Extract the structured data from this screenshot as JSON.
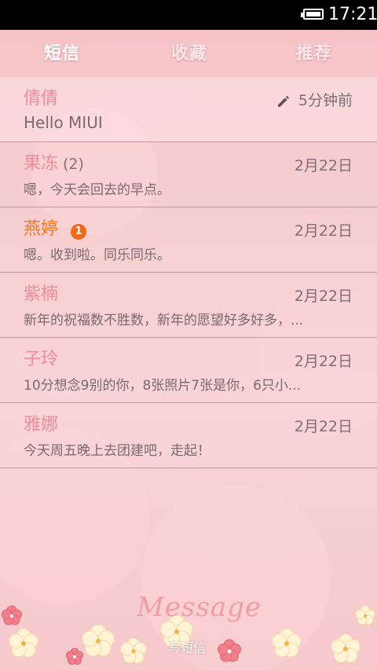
{
  "status_bar": {
    "time": "17:21",
    "battery_icon": "battery-full-icon"
  },
  "tabs": [
    {
      "label": "短信",
      "active": true
    },
    {
      "label": "收藏",
      "active": false
    },
    {
      "label": "推荐",
      "active": false
    }
  ],
  "conversations": [
    {
      "name": "倩倩",
      "count": "",
      "badge": "",
      "date": "5分钟前",
      "preview": "Hello MIUI",
      "draft_icon": "pencil-icon"
    },
    {
      "name": "果冻",
      "count": "(2)",
      "badge": "",
      "date": "2月22日",
      "preview": "嗯，今天会回去的早点。"
    },
    {
      "name": "燕婷",
      "count": "",
      "badge": "1",
      "date": "2月22日",
      "preview": "嗯。收到啦。同乐同乐。"
    },
    {
      "name": "紫楠",
      "count": "",
      "badge": "",
      "date": "2月22日",
      "preview": "新年的祝福数不胜数，新年的愿望好多好多，..."
    },
    {
      "name": "子玲",
      "count": "",
      "badge": "",
      "date": "2月22日",
      "preview": "10分想念9别的你，8张照片7张是你，6只小..."
    },
    {
      "name": "雅娜",
      "count": "",
      "badge": "",
      "date": "2月22日",
      "preview": "今天周五晚上去团建吧，走起！"
    }
  ],
  "footer": {
    "title": "Message",
    "compose_label": "写短信"
  },
  "colors": {
    "name": "#ef8c97",
    "unread_name": "#f07a1e",
    "badge": "#ef6a1a",
    "background": "#f7cdcf"
  }
}
